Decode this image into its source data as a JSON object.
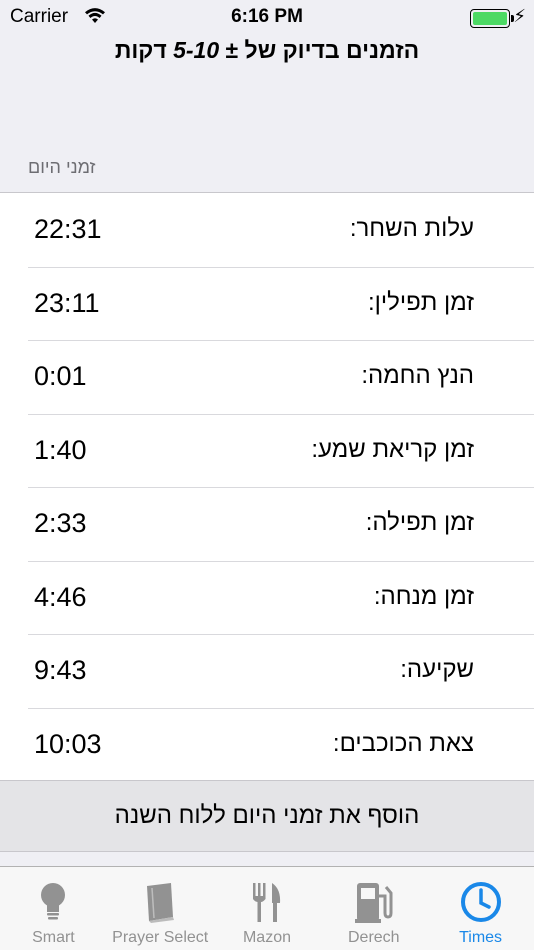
{
  "status_bar": {
    "carrier": "Carrier",
    "time": "6:16 PM",
    "battery_level": 1.0
  },
  "header": {
    "title_prefix": "הזמנים בדיוק של ± ",
    "title_range": "5-10",
    "title_suffix": " דקות"
  },
  "section": {
    "title": "זמני היום"
  },
  "times": [
    {
      "label": "עלות השחר:",
      "value": "22:31"
    },
    {
      "label": "זמן תפילין:",
      "value": "23:11"
    },
    {
      "label": "הנץ החמה:",
      "value": "0:01"
    },
    {
      "label": "זמן קריאת שמע:",
      "value": "1:40"
    },
    {
      "label": "זמן תפילה:",
      "value": "2:33"
    },
    {
      "label": "זמן מנחה:",
      "value": "4:46"
    },
    {
      "label": "שקיעה:",
      "value": "9:43"
    },
    {
      "label": "צאת הכוכבים:",
      "value": "10:03"
    }
  ],
  "add_button": {
    "label": "הוסף את זמני היום ללוח השנה"
  },
  "tabs": [
    {
      "label": "Smart",
      "icon": "lightbulb-icon",
      "active": false
    },
    {
      "label": "Prayer Select",
      "icon": "book-icon",
      "active": false
    },
    {
      "label": "Mazon",
      "icon": "fork-knife-icon",
      "active": false
    },
    {
      "label": "Derech",
      "icon": "gas-pump-icon",
      "active": false
    },
    {
      "label": "Times",
      "icon": "clock-icon",
      "active": true
    }
  ],
  "colors": {
    "accent": "#1a88e8",
    "inactive_tab": "#929292",
    "background": "#efeff4",
    "battery": "#4cd964"
  }
}
